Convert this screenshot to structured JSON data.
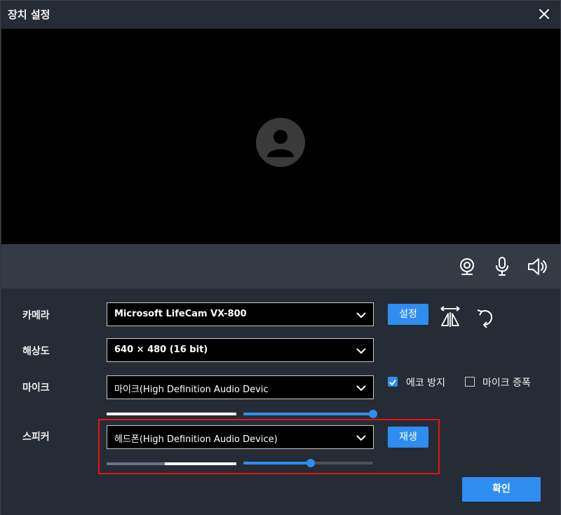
{
  "window": {
    "title": "장치 설정"
  },
  "icons": {
    "close": "close-icon",
    "avatar": "user-avatar-icon",
    "camera": "webcam-icon",
    "mic": "microphone-icon",
    "speaker": "speaker-icon",
    "mirror": "flip-horizontal-icon",
    "rotate": "rotate-icon",
    "chevron": "chevron-down-icon"
  },
  "settings": {
    "camera": {
      "label": "카메라",
      "value": "Microsoft LifeCam VX-800",
      "settings_button": "설정"
    },
    "resolution": {
      "label": "해상도",
      "value": "640 × 480 (16 bit)"
    },
    "mic": {
      "label": "마이크",
      "value": "마이크(High Definition Audio Devic",
      "level": 1.0,
      "volume": 1.0,
      "echo_cancel": {
        "label": "에코 방지",
        "checked": true
      },
      "mic_boost": {
        "label": "마이크 증폭",
        "checked": false
      }
    },
    "speaker": {
      "label": "스피커",
      "value": "헤드폰(High Definition Audio Device)",
      "play_button": "재생",
      "level": 0.45,
      "volume": 0.52
    }
  },
  "footer": {
    "confirm_button": "확인"
  },
  "colors": {
    "accent": "#2f8df0",
    "highlight": "#e31414",
    "background": "#262c35",
    "device_bar": "#353b45"
  }
}
